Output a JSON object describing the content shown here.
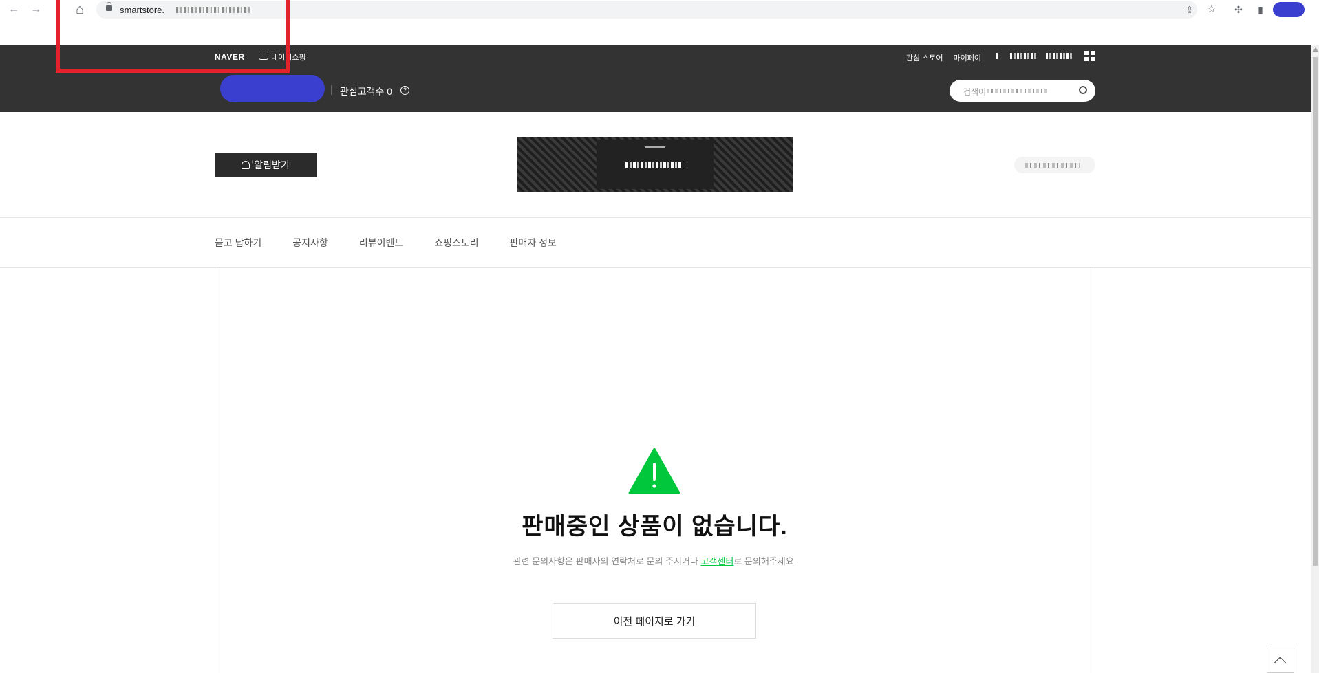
{
  "browser": {
    "url": "smartstore.",
    "back_icon": "←",
    "forward_icon": "→",
    "home_icon": "⌂",
    "share_icon": "⇪",
    "star_icon": "☆",
    "extensions_icon": "✣",
    "sidepanel_icon": "▮"
  },
  "header": {
    "logo": "NAVER",
    "shop_label": "네이버쇼핑",
    "top_links": [
      "관심 스토어",
      "마이페이"
    ],
    "follower_label": "관심고객수 0",
    "help_icon": "?",
    "search_placeholder": "검색어"
  },
  "store": {
    "alert_button": "알림받기"
  },
  "store_nav": [
    "묻고 답하기",
    "공지사항",
    "리뷰이벤트",
    "쇼핑스토리",
    "판매자 정보"
  ],
  "empty_state": {
    "title": "판매중인 상품이 없습니다.",
    "desc_before": "관련 문의사항은 판매자의 연락처로 문의 주시거나 ",
    "desc_link": "고객센터",
    "desc_after": "로 문의해주세요.",
    "back_button": "이전 페이지로 가기",
    "warning_color": "#00c73c"
  }
}
